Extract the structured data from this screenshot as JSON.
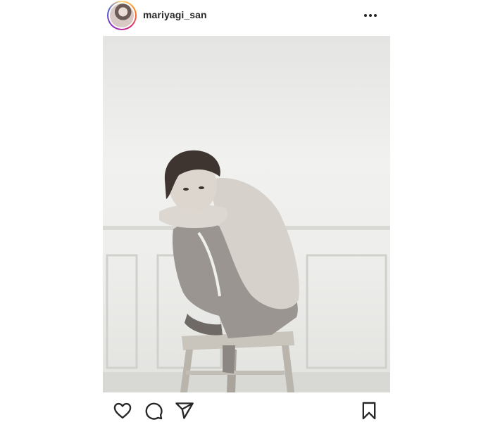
{
  "post": {
    "username": "mariyagi_san",
    "avatar_icon": "avatar-photo",
    "more_icon": "more-options-icon",
    "photo_description_colors": {
      "wall": "#eeeeec",
      "wainscot_line": "#d3d3d0"
    },
    "actions": {
      "like_icon": "heart-icon",
      "comment_icon": "comment-icon",
      "share_icon": "share-icon",
      "save_icon": "bookmark-icon"
    }
  }
}
